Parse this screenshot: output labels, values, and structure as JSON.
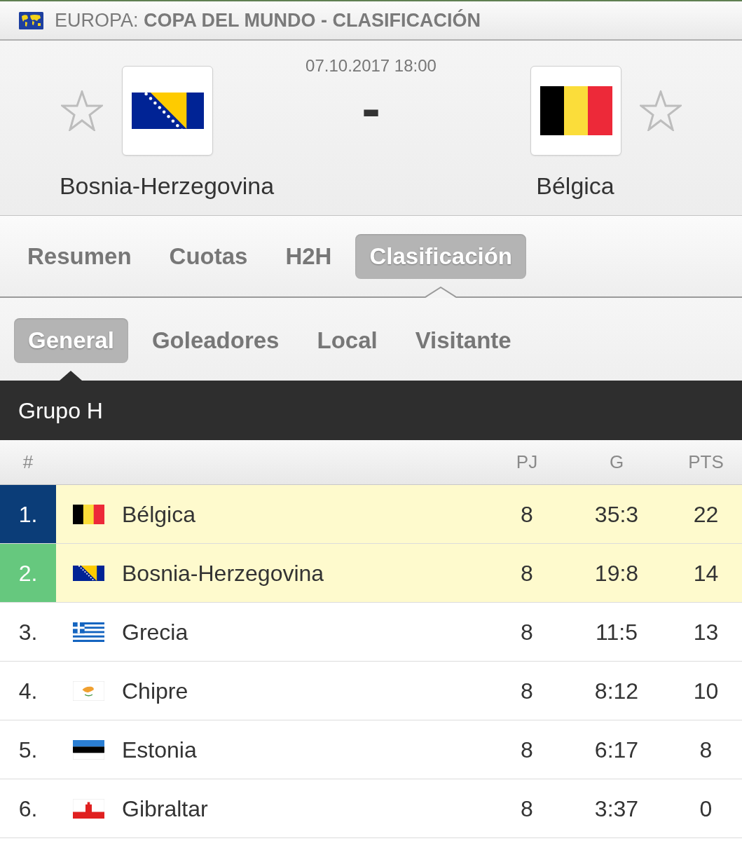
{
  "header": {
    "title": "EUROPA: **COPA DEL MUNDO - CLASIFICACIÓN**"
  },
  "match": {
    "datetime": "07.10.2017 18:00",
    "score": "-",
    "home": {
      "name": "Bosnia-Herzegovina",
      "flag": {
        "kind": "bih"
      },
      "favorite": false
    },
    "away": {
      "name": "Bélgica",
      "flag": {
        "kind": "bel"
      },
      "favorite": false
    }
  },
  "tabs": [
    {
      "label": "Resumen",
      "selected": false
    },
    {
      "label": "Cuotas",
      "selected": false
    },
    {
      "label": "H2H",
      "selected": false
    },
    {
      "label": "Clasificación",
      "selected": true
    }
  ],
  "subtabs": [
    {
      "label": "General",
      "selected": true
    },
    {
      "label": "Goleadores",
      "selected": false
    },
    {
      "label": "Local",
      "selected": false
    },
    {
      "label": "Visitante",
      "selected": false
    }
  ],
  "standings": {
    "group": "Grupo H",
    "columns": [
      "#",
      "PJ",
      "G",
      "PTS"
    ],
    "rows": [
      {
        "rank": "1.",
        "flag": {
          "kind": "bel"
        },
        "team": "Bélgica",
        "played": "8",
        "goals": "35:3",
        "points": "22",
        "highlighted": true,
        "color": "#0b3d78"
      },
      {
        "rank": "2.",
        "flag": {
          "kind": "bih"
        },
        "team": "Bosnia-Herzegovina",
        "played": "8",
        "goals": "19:8",
        "points": "14",
        "highlighted": true,
        "color": "#66c87e"
      },
      {
        "rank": "3.",
        "flag": {
          "kind": "grc"
        },
        "team": "Grecia",
        "played": "8",
        "goals": "11:5",
        "points": "13",
        "highlighted": false
      },
      {
        "rank": "4.",
        "flag": {
          "kind": "cyp"
        },
        "team": "Chipre",
        "played": "8",
        "goals": "8:12",
        "points": "10",
        "highlighted": false
      },
      {
        "rank": "5.",
        "flag": {
          "kind": "est"
        },
        "team": "Estonia",
        "played": "8",
        "goals": "6:17",
        "points": "8",
        "highlighted": false
      },
      {
        "rank": "6.",
        "flag": {
          "kind": "gib"
        },
        "team": "Gibraltar",
        "played": "8",
        "goals": "3:37",
        "points": "0",
        "highlighted": false
      }
    ]
  }
}
